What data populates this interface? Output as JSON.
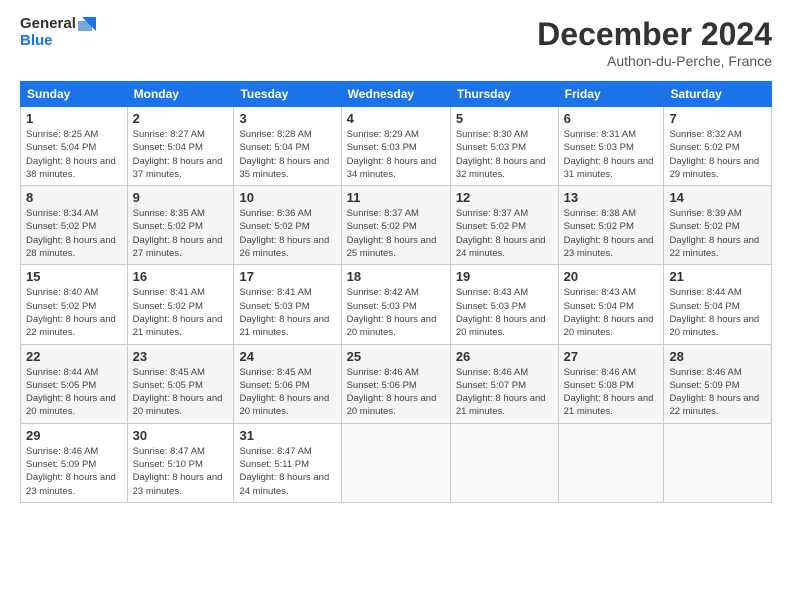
{
  "logo": {
    "line1": "General",
    "line2": "Blue"
  },
  "title": "December 2024",
  "location": "Authon-du-Perche, France",
  "headers": [
    "Sunday",
    "Monday",
    "Tuesday",
    "Wednesday",
    "Thursday",
    "Friday",
    "Saturday"
  ],
  "weeks": [
    [
      {
        "day": "1",
        "sunrise": "8:25 AM",
        "sunset": "5:04 PM",
        "daylight": "8 hours and 38 minutes."
      },
      {
        "day": "2",
        "sunrise": "8:27 AM",
        "sunset": "5:04 PM",
        "daylight": "8 hours and 37 minutes."
      },
      {
        "day": "3",
        "sunrise": "8:28 AM",
        "sunset": "5:04 PM",
        "daylight": "8 hours and 35 minutes."
      },
      {
        "day": "4",
        "sunrise": "8:29 AM",
        "sunset": "5:03 PM",
        "daylight": "8 hours and 34 minutes."
      },
      {
        "day": "5",
        "sunrise": "8:30 AM",
        "sunset": "5:03 PM",
        "daylight": "8 hours and 32 minutes."
      },
      {
        "day": "6",
        "sunrise": "8:31 AM",
        "sunset": "5:03 PM",
        "daylight": "8 hours and 31 minutes."
      },
      {
        "day": "7",
        "sunrise": "8:32 AM",
        "sunset": "5:02 PM",
        "daylight": "8 hours and 29 minutes."
      }
    ],
    [
      {
        "day": "8",
        "sunrise": "8:34 AM",
        "sunset": "5:02 PM",
        "daylight": "8 hours and 28 minutes."
      },
      {
        "day": "9",
        "sunrise": "8:35 AM",
        "sunset": "5:02 PM",
        "daylight": "8 hours and 27 minutes."
      },
      {
        "day": "10",
        "sunrise": "8:36 AM",
        "sunset": "5:02 PM",
        "daylight": "8 hours and 26 minutes."
      },
      {
        "day": "11",
        "sunrise": "8:37 AM",
        "sunset": "5:02 PM",
        "daylight": "8 hours and 25 minutes."
      },
      {
        "day": "12",
        "sunrise": "8:37 AM",
        "sunset": "5:02 PM",
        "daylight": "8 hours and 24 minutes."
      },
      {
        "day": "13",
        "sunrise": "8:38 AM",
        "sunset": "5:02 PM",
        "daylight": "8 hours and 23 minutes."
      },
      {
        "day": "14",
        "sunrise": "8:39 AM",
        "sunset": "5:02 PM",
        "daylight": "8 hours and 22 minutes."
      }
    ],
    [
      {
        "day": "15",
        "sunrise": "8:40 AM",
        "sunset": "5:02 PM",
        "daylight": "8 hours and 22 minutes."
      },
      {
        "day": "16",
        "sunrise": "8:41 AM",
        "sunset": "5:02 PM",
        "daylight": "8 hours and 21 minutes."
      },
      {
        "day": "17",
        "sunrise": "8:41 AM",
        "sunset": "5:03 PM",
        "daylight": "8 hours and 21 minutes."
      },
      {
        "day": "18",
        "sunrise": "8:42 AM",
        "sunset": "5:03 PM",
        "daylight": "8 hours and 20 minutes."
      },
      {
        "day": "19",
        "sunrise": "8:43 AM",
        "sunset": "5:03 PM",
        "daylight": "8 hours and 20 minutes."
      },
      {
        "day": "20",
        "sunrise": "8:43 AM",
        "sunset": "5:04 PM",
        "daylight": "8 hours and 20 minutes."
      },
      {
        "day": "21",
        "sunrise": "8:44 AM",
        "sunset": "5:04 PM",
        "daylight": "8 hours and 20 minutes."
      }
    ],
    [
      {
        "day": "22",
        "sunrise": "8:44 AM",
        "sunset": "5:05 PM",
        "daylight": "8 hours and 20 minutes."
      },
      {
        "day": "23",
        "sunrise": "8:45 AM",
        "sunset": "5:05 PM",
        "daylight": "8 hours and 20 minutes."
      },
      {
        "day": "24",
        "sunrise": "8:45 AM",
        "sunset": "5:06 PM",
        "daylight": "8 hours and 20 minutes."
      },
      {
        "day": "25",
        "sunrise": "8:46 AM",
        "sunset": "5:06 PM",
        "daylight": "8 hours and 20 minutes."
      },
      {
        "day": "26",
        "sunrise": "8:46 AM",
        "sunset": "5:07 PM",
        "daylight": "8 hours and 21 minutes."
      },
      {
        "day": "27",
        "sunrise": "8:46 AM",
        "sunset": "5:08 PM",
        "daylight": "8 hours and 21 minutes."
      },
      {
        "day": "28",
        "sunrise": "8:46 AM",
        "sunset": "5:09 PM",
        "daylight": "8 hours and 22 minutes."
      }
    ],
    [
      {
        "day": "29",
        "sunrise": "8:46 AM",
        "sunset": "5:09 PM",
        "daylight": "8 hours and 23 minutes."
      },
      {
        "day": "30",
        "sunrise": "8:47 AM",
        "sunset": "5:10 PM",
        "daylight": "8 hours and 23 minutes."
      },
      {
        "day": "31",
        "sunrise": "8:47 AM",
        "sunset": "5:11 PM",
        "daylight": "8 hours and 24 minutes."
      },
      null,
      null,
      null,
      null
    ]
  ],
  "labels": {
    "sunrise": "Sunrise:",
    "sunset": "Sunset:",
    "daylight": "Daylight:"
  }
}
